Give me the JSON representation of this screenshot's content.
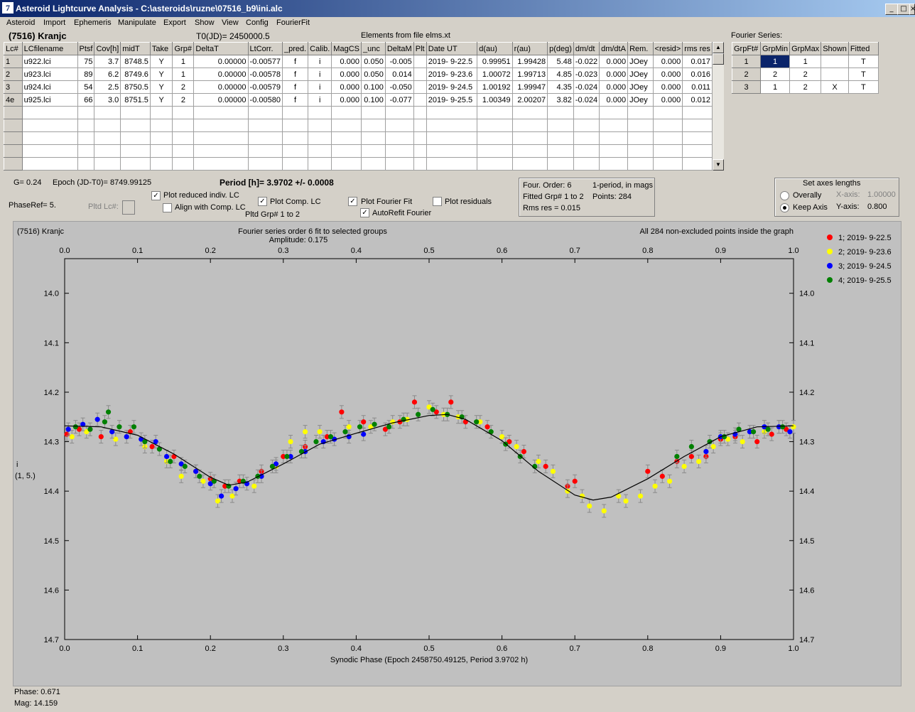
{
  "window": {
    "title": "Asteroid Lightcurve Analysis - C:\\asteroids\\ruzne\\07516_b9\\ini.alc",
    "icon_text": "7"
  },
  "menu": [
    "Asteroid",
    "Import",
    "Ephemeris",
    "Manipulate",
    "Export",
    "Show",
    "View",
    "Config",
    "FourierFit"
  ],
  "header": {
    "asteroid": "(7516) Kranjc",
    "t0": "T0(JD)= 2450000.5",
    "elements": "Elements from file elms.xt",
    "fourier_series_label": "Fourier Series:"
  },
  "lc_table": {
    "columns": [
      "Lc#",
      "LCfilename",
      "Ptsf",
      "Cov[h]",
      "midT",
      "Take",
      "Grp#",
      "DeltaT",
      "LtCorr.",
      "_pred.",
      "Calib.",
      "MagCS",
      "_unc",
      "DeltaM",
      "Plt",
      "Date UT",
      "d(au)",
      "r(au)",
      "p(deg)",
      "dm/dt",
      "dm/dtA",
      "Rem.",
      "<resid>",
      "rms res"
    ],
    "rows": [
      [
        "1",
        "u922.lci",
        "75",
        "3.7",
        "8748.5",
        "Y",
        "1",
        "0.00000",
        "-0.00577",
        "f",
        "i",
        "0.000",
        "0.050",
        "-0.005",
        "",
        "2019- 9-22.5",
        "0.99951",
        "1.99428",
        "5.48",
        "-0.022",
        "0.000",
        "JOey",
        "0.000",
        "0.017"
      ],
      [
        "2",
        "u923.lci",
        "89",
        "6.2",
        "8749.6",
        "Y",
        "1",
        "0.00000",
        "-0.00578",
        "f",
        "i",
        "0.000",
        "0.050",
        "0.014",
        "",
        "2019- 9-23.6",
        "1.00072",
        "1.99713",
        "4.85",
        "-0.023",
        "0.000",
        "JOey",
        "0.000",
        "0.016"
      ],
      [
        "3",
        "u924.lci",
        "54",
        "2.5",
        "8750.5",
        "Y",
        "2",
        "0.00000",
        "-0.00579",
        "f",
        "i",
        "0.000",
        "0.100",
        "-0.050",
        "",
        "2019- 9-24.5",
        "1.00192",
        "1.99947",
        "4.35",
        "-0.024",
        "0.000",
        "JOey",
        "0.000",
        "0.011"
      ],
      [
        "4e",
        "u925.lci",
        "66",
        "3.0",
        "8751.5",
        "Y",
        "2",
        "0.00000",
        "-0.00580",
        "f",
        "i",
        "0.000",
        "0.100",
        "-0.077",
        "",
        "2019- 9-25.5",
        "1.00349",
        "2.00207",
        "3.82",
        "-0.024",
        "0.000",
        "JOey",
        "0.000",
        "0.012"
      ]
    ],
    "empty_rows": 6
  },
  "fourier_table": {
    "columns": [
      "GrpFt#",
      "GrpMin",
      "GrpMax",
      "Shown",
      "Fitted"
    ],
    "rows": [
      [
        "1",
        "1",
        "1",
        "",
        "T"
      ],
      [
        "2",
        "2",
        "2",
        "",
        "T"
      ],
      [
        "3",
        "1",
        "2",
        "X",
        "T"
      ]
    ]
  },
  "info": {
    "g": "G= 0.24",
    "epoch": "Epoch (JD-T0)= 8749.99125",
    "period": "Period [h]= 3.9702 +/- 0.0008",
    "phaseref": "PhaseRef= 5.",
    "pltd_lc": "Pltd Lc#:",
    "plot_reduced": "Plot reduced indiv. LC",
    "align_comp": "Align with Comp. LC",
    "plot_comp": "Plot Comp. LC",
    "pltd_grp": "Pltd Grp#  1   to   2",
    "plot_fourier": "Plot Fourier Fit",
    "autorefit": "AutoRefit Fourier",
    "plot_residuals": "Plot residuals",
    "four_order": "Four. Order:  6",
    "one_period": "1-period, in mags",
    "fitted_grp": "Fitted Grp# 1 to 2",
    "points": "Points: 284",
    "rms": "Rms res      = 0.015",
    "axes_title": "Set axes lengths",
    "overally": "Overally",
    "keep_axis": "Keep Axis",
    "xaxis_label": "X-axis:",
    "xaxis_val": "1.00000",
    "yaxis_label": "Y-axis:",
    "yaxis_val": "0.800"
  },
  "status": {
    "phase": "Phase:  0.671",
    "mag": "Mag:    14.159"
  },
  "chart_data": {
    "type": "scatter",
    "title_left": "(7516) Kranjc",
    "title": "Fourier series order 6 fit to selected groups",
    "subtitle": "Amplitude: 0.175",
    "title_right": "All 284 non-excluded points inside the graph",
    "xlabel": "Synodic Phase (Epoch 2458750.49125, Period 3.9702 h)",
    "ylabel": "i",
    "ylabel2": "(1, 5.)",
    "xlim": [
      0.0,
      1.0
    ],
    "ylim": [
      14.7,
      13.93
    ],
    "x_ticks": [
      "0.0",
      "0.1",
      "0.2",
      "0.3",
      "0.4",
      "0.5",
      "0.6",
      "0.7",
      "0.8",
      "0.9",
      "1.0"
    ],
    "y_ticks": [
      "14.0",
      "14.1",
      "14.2",
      "14.3",
      "14.4",
      "14.5",
      "14.6",
      "14.7"
    ],
    "y_tick_values": [
      14.0,
      14.1,
      14.2,
      14.3,
      14.4,
      14.5,
      14.6,
      14.7
    ],
    "fit_curve": {
      "x": [
        0,
        0.05,
        0.1,
        0.15,
        0.2,
        0.225,
        0.25,
        0.3,
        0.35,
        0.4,
        0.45,
        0.5,
        0.525,
        0.55,
        0.6,
        0.65,
        0.7,
        0.725,
        0.75,
        0.8,
        0.85,
        0.9,
        0.95,
        1.0
      ],
      "y": [
        14.268,
        14.27,
        14.287,
        14.325,
        14.372,
        14.388,
        14.382,
        14.345,
        14.305,
        14.283,
        14.262,
        14.247,
        14.245,
        14.255,
        14.298,
        14.36,
        14.408,
        14.418,
        14.412,
        14.375,
        14.33,
        14.29,
        14.27,
        14.268
      ]
    },
    "series": [
      {
        "name": "1; 2019- 9-22.5",
        "color": "#ff0000",
        "points": [
          [
            0.003,
            14.285
          ],
          [
            0.02,
            14.275
          ],
          [
            0.05,
            14.29
          ],
          [
            0.09,
            14.28
          ],
          [
            0.12,
            14.31
          ],
          [
            0.15,
            14.33
          ],
          [
            0.18,
            14.36
          ],
          [
            0.2,
            14.375
          ],
          [
            0.22,
            14.39
          ],
          [
            0.24,
            14.38
          ],
          [
            0.27,
            14.36
          ],
          [
            0.3,
            14.33
          ],
          [
            0.33,
            14.31
          ],
          [
            0.36,
            14.29
          ],
          [
            0.38,
            14.24
          ],
          [
            0.41,
            14.26
          ],
          [
            0.44,
            14.275
          ],
          [
            0.46,
            14.26
          ],
          [
            0.48,
            14.22
          ],
          [
            0.51,
            14.24
          ],
          [
            0.53,
            14.22
          ],
          [
            0.55,
            14.26
          ],
          [
            0.58,
            14.27
          ],
          [
            0.61,
            14.3
          ],
          [
            0.63,
            14.32
          ],
          [
            0.66,
            14.35
          ],
          [
            0.69,
            14.39
          ],
          [
            0.7,
            14.38
          ],
          [
            0.8,
            14.36
          ],
          [
            0.82,
            14.37
          ],
          [
            0.84,
            14.34
          ],
          [
            0.86,
            14.33
          ],
          [
            0.88,
            14.33
          ],
          [
            0.9,
            14.295
          ],
          [
            0.92,
            14.29
          ],
          [
            0.95,
            14.3
          ],
          [
            0.97,
            14.285
          ],
          [
            0.99,
            14.275
          ]
        ]
      },
      {
        "name": "2; 2019- 9-23.6",
        "color": "#ffff00",
        "points": [
          [
            0.01,
            14.29
          ],
          [
            0.03,
            14.28
          ],
          [
            0.07,
            14.295
          ],
          [
            0.11,
            14.31
          ],
          [
            0.14,
            14.34
          ],
          [
            0.16,
            14.37
          ],
          [
            0.19,
            14.38
          ],
          [
            0.21,
            14.42
          ],
          [
            0.23,
            14.41
          ],
          [
            0.26,
            14.39
          ],
          [
            0.29,
            14.35
          ],
          [
            0.31,
            14.3
          ],
          [
            0.33,
            14.28
          ],
          [
            0.35,
            14.28
          ],
          [
            0.39,
            14.27
          ],
          [
            0.42,
            14.27
          ],
          [
            0.45,
            14.26
          ],
          [
            0.47,
            14.255
          ],
          [
            0.5,
            14.23
          ],
          [
            0.52,
            14.245
          ],
          [
            0.54,
            14.25
          ],
          [
            0.57,
            14.26
          ],
          [
            0.6,
            14.29
          ],
          [
            0.62,
            14.31
          ],
          [
            0.65,
            14.34
          ],
          [
            0.67,
            14.36
          ],
          [
            0.69,
            14.4
          ],
          [
            0.71,
            14.41
          ],
          [
            0.72,
            14.43
          ],
          [
            0.74,
            14.44
          ],
          [
            0.76,
            14.41
          ],
          [
            0.77,
            14.42
          ],
          [
            0.79,
            14.41
          ],
          [
            0.81,
            14.39
          ],
          [
            0.83,
            14.38
          ],
          [
            0.85,
            14.35
          ],
          [
            0.87,
            14.34
          ],
          [
            0.89,
            14.31
          ],
          [
            0.91,
            14.295
          ],
          [
            0.93,
            14.3
          ],
          [
            0.96,
            14.28
          ],
          [
            0.98,
            14.27
          ],
          [
            1.0,
            14.27
          ]
        ]
      },
      {
        "name": "3; 2019- 9-24.5",
        "color": "#0000ff",
        "points": [
          [
            0.005,
            14.275
          ],
          [
            0.025,
            14.265
          ],
          [
            0.045,
            14.255
          ],
          [
            0.065,
            14.28
          ],
          [
            0.085,
            14.29
          ],
          [
            0.105,
            14.295
          ],
          [
            0.125,
            14.3
          ],
          [
            0.14,
            14.33
          ],
          [
            0.16,
            14.345
          ],
          [
            0.18,
            14.36
          ],
          [
            0.2,
            14.385
          ],
          [
            0.215,
            14.41
          ],
          [
            0.235,
            14.395
          ],
          [
            0.25,
            14.385
          ],
          [
            0.27,
            14.37
          ],
          [
            0.29,
            14.345
          ],
          [
            0.31,
            14.33
          ],
          [
            0.33,
            14.32
          ],
          [
            0.355,
            14.3
          ],
          [
            0.37,
            14.295
          ],
          [
            0.39,
            14.29
          ],
          [
            0.41,
            14.285
          ],
          [
            0.88,
            14.32
          ],
          [
            0.9,
            14.29
          ],
          [
            0.92,
            14.285
          ],
          [
            0.94,
            14.28
          ],
          [
            0.96,
            14.27
          ],
          [
            0.98,
            14.27
          ],
          [
            0.995,
            14.28
          ]
        ]
      },
      {
        "name": "4; 2019- 9-25.5",
        "color": "#008000",
        "points": [
          [
            0.015,
            14.27
          ],
          [
            0.035,
            14.275
          ],
          [
            0.055,
            14.26
          ],
          [
            0.06,
            14.24
          ],
          [
            0.075,
            14.27
          ],
          [
            0.095,
            14.27
          ],
          [
            0.11,
            14.3
          ],
          [
            0.13,
            14.315
          ],
          [
            0.145,
            14.34
          ],
          [
            0.165,
            14.35
          ],
          [
            0.185,
            14.37
          ],
          [
            0.205,
            14.38
          ],
          [
            0.225,
            14.39
          ],
          [
            0.245,
            14.38
          ],
          [
            0.265,
            14.37
          ],
          [
            0.285,
            14.35
          ],
          [
            0.305,
            14.33
          ],
          [
            0.325,
            14.32
          ],
          [
            0.345,
            14.3
          ],
          [
            0.365,
            14.29
          ],
          [
            0.385,
            14.28
          ],
          [
            0.405,
            14.27
          ],
          [
            0.425,
            14.265
          ],
          [
            0.445,
            14.27
          ],
          [
            0.465,
            14.255
          ],
          [
            0.485,
            14.245
          ],
          [
            0.505,
            14.235
          ],
          [
            0.525,
            14.245
          ],
          [
            0.545,
            14.25
          ],
          [
            0.565,
            14.26
          ],
          [
            0.585,
            14.28
          ],
          [
            0.605,
            14.305
          ],
          [
            0.625,
            14.33
          ],
          [
            0.645,
            14.35
          ],
          [
            0.84,
            14.33
          ],
          [
            0.86,
            14.31
          ],
          [
            0.885,
            14.3
          ],
          [
            0.905,
            14.29
          ],
          [
            0.925,
            14.275
          ],
          [
            0.945,
            14.28
          ],
          [
            0.965,
            14.275
          ],
          [
            0.985,
            14.27
          ]
        ]
      }
    ]
  }
}
